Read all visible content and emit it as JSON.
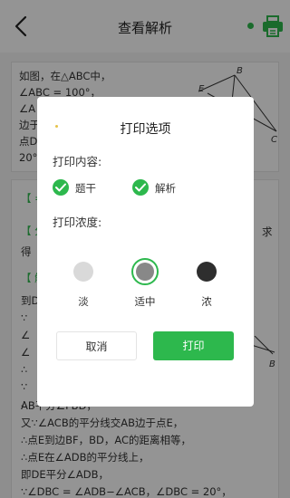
{
  "header": {
    "title": "查看解析"
  },
  "colors": {
    "accent": "#2db84d",
    "light_circle": "#d9d9d9",
    "medium_circle": "#888888",
    "dark_circle": "#2e2e2e"
  },
  "question": {
    "lines": [
      "如图，在△ABC中，",
      "∠ABC = 100°，",
      "∠A",
      "边于",
      "点D",
      "20°"
    ],
    "figure_labels": {
      "b": "B",
      "e": "E",
      "c": "C"
    }
  },
  "analysis": {
    "tag1": "【 =",
    "tag2": "【 分",
    "side_text1": "求",
    "line_de": "得",
    "tag3": "【 解",
    "lines_partial": [
      "到D",
      "∵",
      "∠",
      "∠",
      "∴",
      "∵",
      "∴"
    ],
    "figure_label": "B",
    "lines": [
      "AB平分∠FBD，",
      "又∵∠ACB的平分线交AB边于点E，",
      "∴点E到边BF，BD，AC的距离相等，",
      "∴点E在∠ADB的平分线上，",
      "即DE平分∠ADB，",
      "∵∠DBC = ∠ADB−∠ACB，∠DBC = 20°，"
    ]
  },
  "dialog": {
    "title": "打印选项",
    "content_label": "打印内容:",
    "options": [
      {
        "label": "题干",
        "checked": true
      },
      {
        "label": "解析",
        "checked": true
      }
    ],
    "density_label": "打印浓度:",
    "density_levels": [
      {
        "label": "淡",
        "selected": false
      },
      {
        "label": "适中",
        "selected": true
      },
      {
        "label": "浓",
        "selected": false
      }
    ],
    "cancel_label": "取消",
    "print_label": "打印"
  }
}
